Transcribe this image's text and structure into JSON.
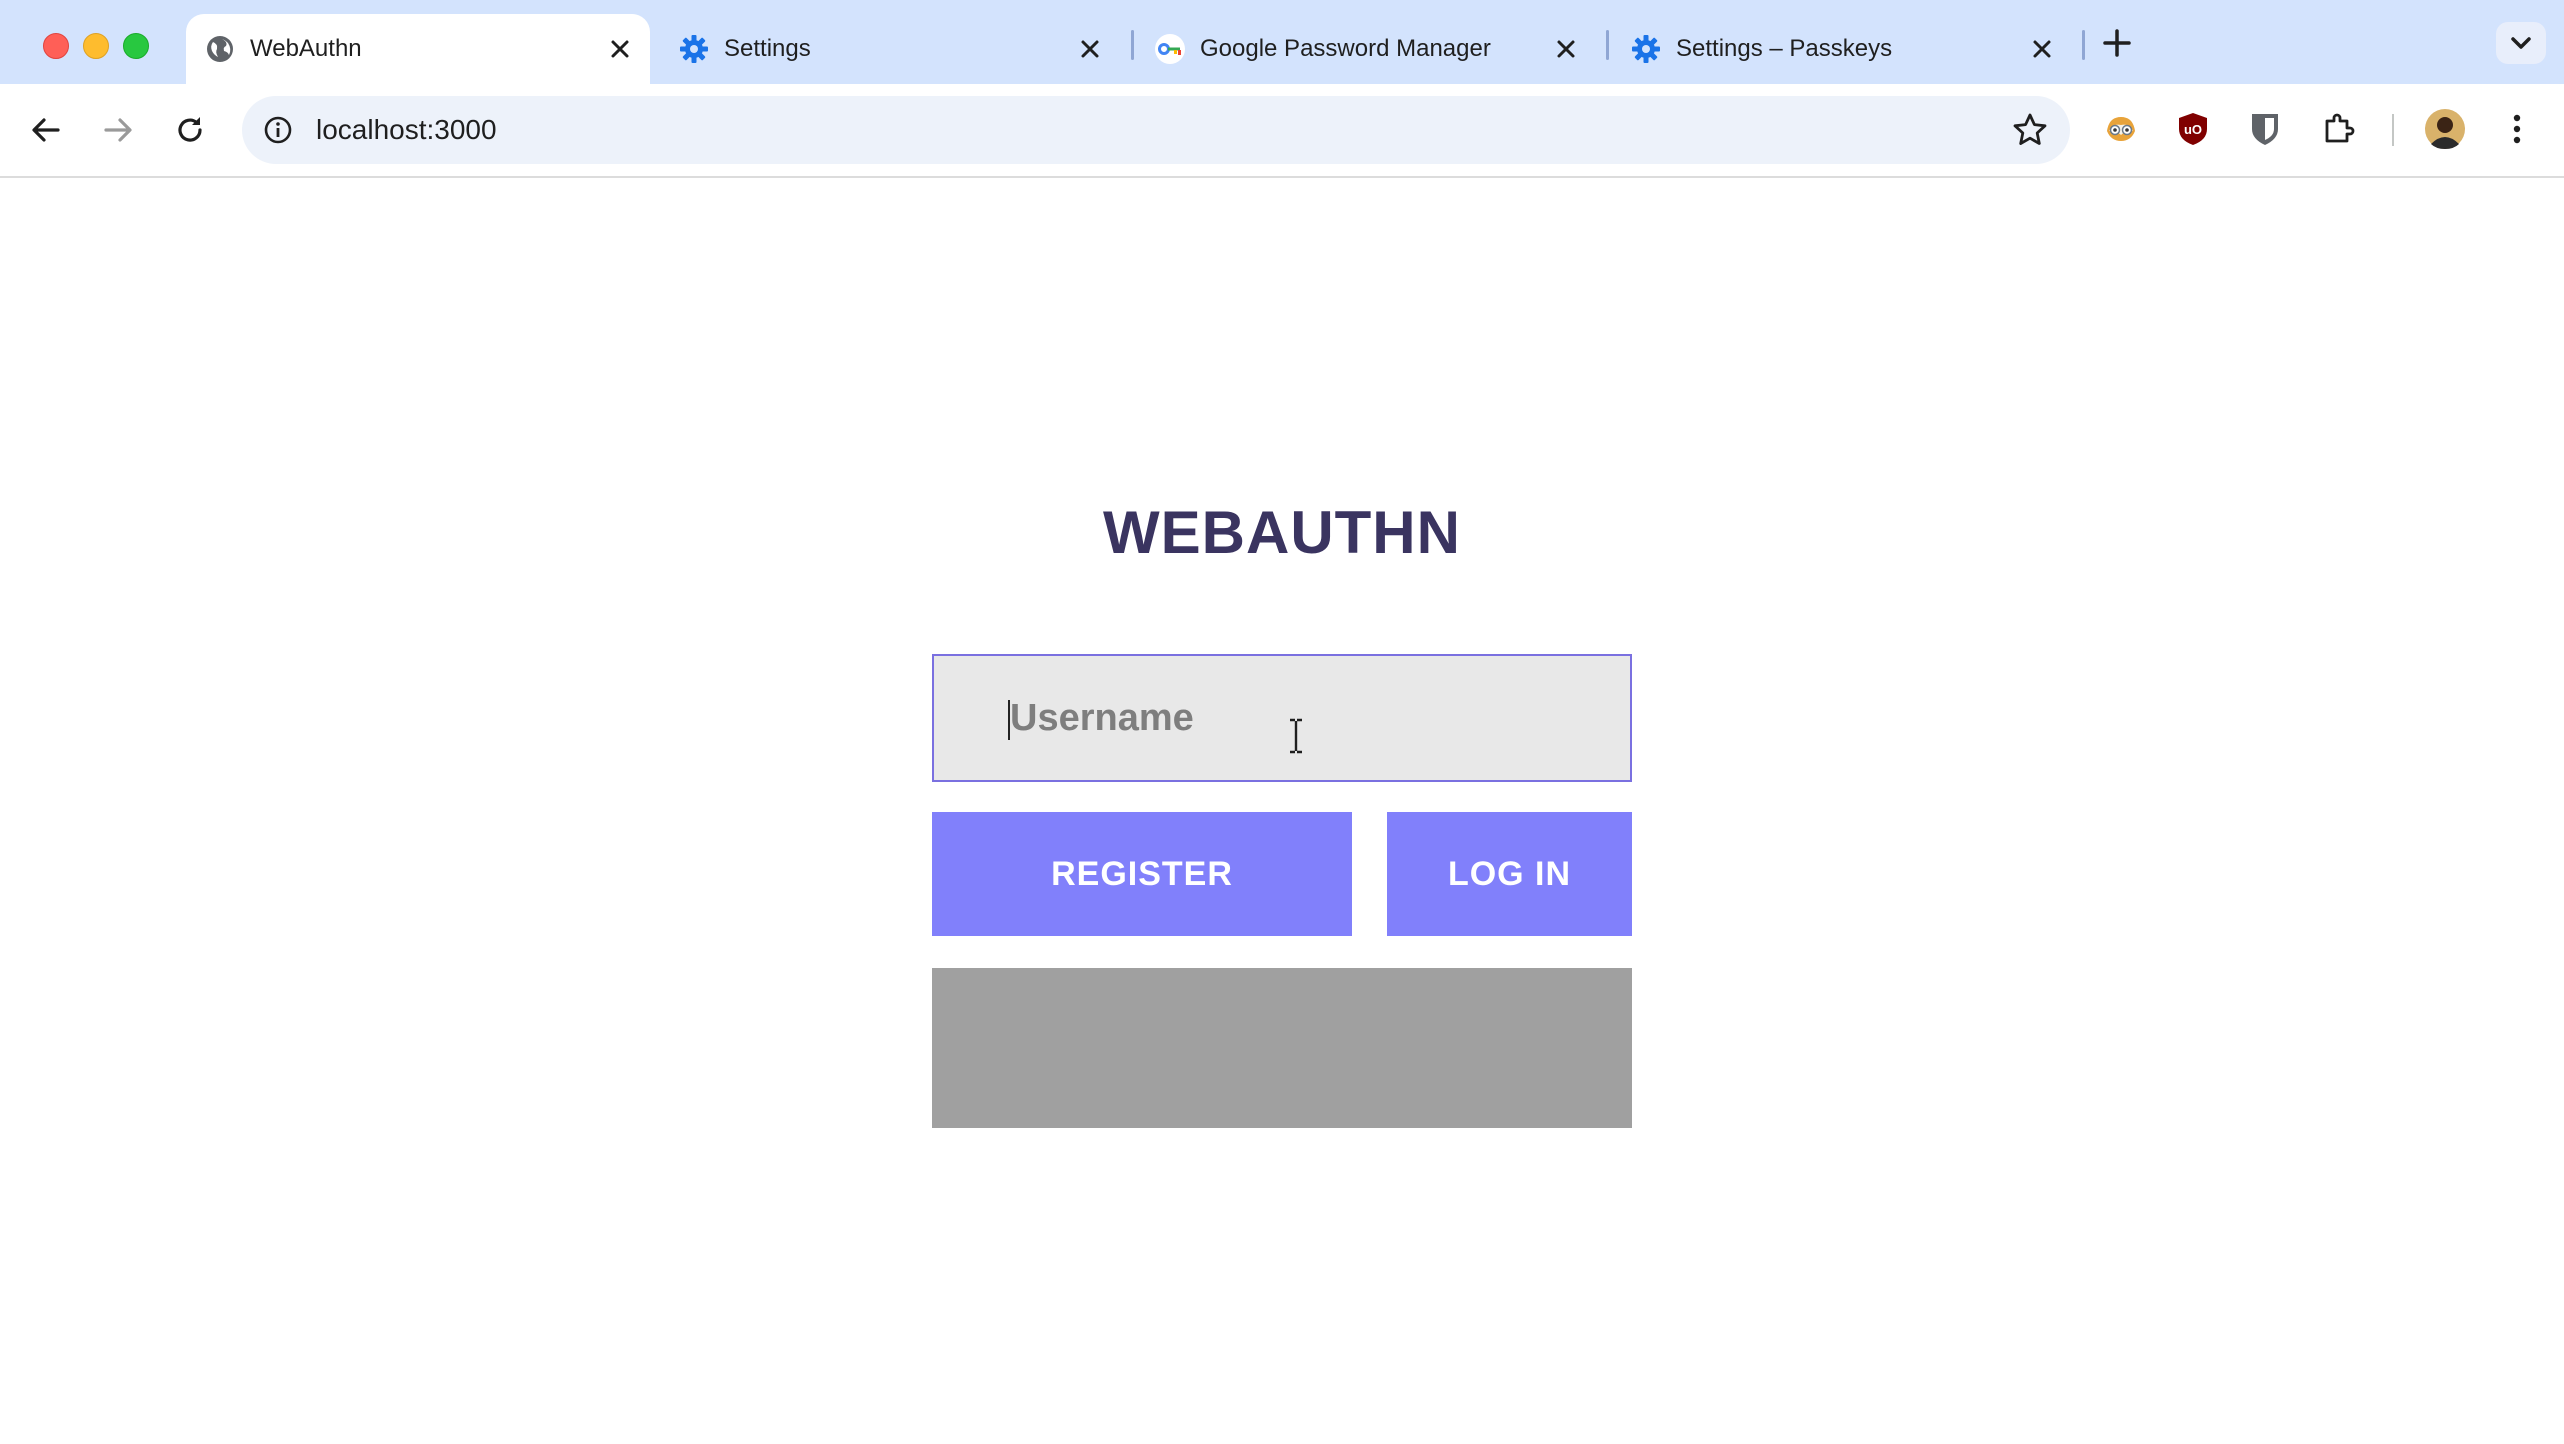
{
  "browser": {
    "tabs": [
      {
        "title": "WebAuthn",
        "icon": "globe-icon",
        "active": true
      },
      {
        "title": "Settings",
        "icon": "gear-icon",
        "active": false
      },
      {
        "title": "Google Password Manager",
        "icon": "password-key-icon",
        "active": false
      },
      {
        "title": "Settings – Passkeys",
        "icon": "gear-icon",
        "active": false
      }
    ],
    "url": "localhost:3000",
    "extensions": [
      "privacy-badger-icon",
      "ublock-origin-icon",
      "bitwarden-icon",
      "extensions-puzzle-icon",
      "profile-avatar-icon",
      "more-menu-icon"
    ]
  },
  "page": {
    "title": "WEBAUTHN",
    "username_placeholder": "Username",
    "username_value": "",
    "register_label": "REGISTER",
    "login_label": "LOG IN",
    "status_text": ""
  },
  "colors": {
    "button": "#8180fb",
    "title": "#3a3460",
    "input_border": "#7a70e0",
    "status_box": "#a0a0a0"
  }
}
